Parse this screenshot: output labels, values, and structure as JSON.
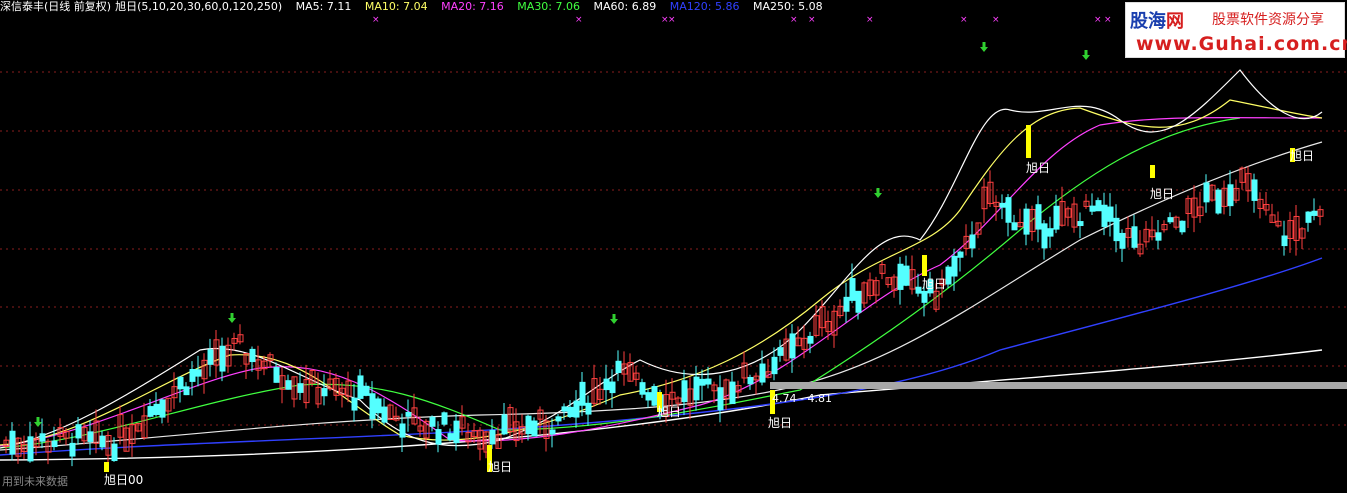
{
  "header": {
    "stock": "深信泰丰(日线 前复权)",
    "indicator": "旭日(5,10,20,30,60,0,120,250)",
    "ma": [
      {
        "label": "MA5: 7.11",
        "color": "#ffffff"
      },
      {
        "label": "MA10: 7.04",
        "color": "#ffff66"
      },
      {
        "label": "MA20: 7.16",
        "color": "#ff40ff"
      },
      {
        "label": "MA30: 7.06",
        "color": "#40ff40"
      },
      {
        "label": "MA60: 6.89",
        "color": "#ffffff"
      },
      {
        "label": "MA120: 5.86",
        "color": "#3040ff"
      },
      {
        "label": "MA250: 5.08",
        "color": "#ffffff"
      }
    ]
  },
  "footer": {
    "text": "用到未来数据"
  },
  "watermark": {
    "brand_a": "股海",
    "brand_b": "网",
    "slogan": "股票软件资源分享",
    "url": "www.Guhai.com.cn"
  },
  "chart_data": {
    "type": "candlestick",
    "markers": {
      "signal_label": "旭日",
      "signal_label_extra": "00",
      "price_range_label": "4.74 - 4.81",
      "buy_arrow_icon": "green-down-arrow-icon",
      "cross_icon": "magenta-x-icon"
    },
    "colors": {
      "up": "#ff4040",
      "down": "#54ffff",
      "signal": "#ffff00",
      "grid": "#8a1e1e"
    }
  }
}
